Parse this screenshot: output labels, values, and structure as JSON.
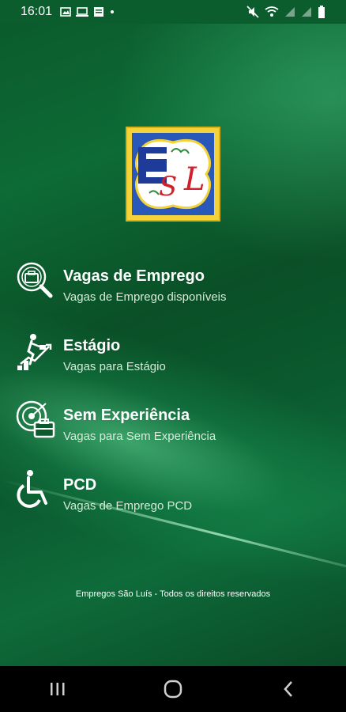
{
  "status_bar": {
    "time": "16:01",
    "left_icons": [
      "image-icon",
      "laptop-icon",
      "news-icon",
      "dot-icon"
    ],
    "right_icons": [
      "mute-icon",
      "wifi-icon",
      "signal-icon",
      "signal-icon",
      "battery-icon"
    ]
  },
  "logo": {
    "letters": [
      "E",
      "S",
      "L"
    ]
  },
  "menu": {
    "items": [
      {
        "title": "Vagas de Emprego",
        "subtitle": "Vagas de Emprego disponíveis",
        "icon": "job-search-icon"
      },
      {
        "title": "Estágio",
        "subtitle": "Vagas para Estágio",
        "icon": "career-growth-icon"
      },
      {
        "title": "Sem Experiência",
        "subtitle": "Vagas para Sem Experiência",
        "icon": "target-briefcase-icon"
      },
      {
        "title": "PCD",
        "subtitle": "Vagas de Emprego PCD",
        "icon": "wheelchair-icon"
      }
    ]
  },
  "footer": {
    "text": "Empregos São Luís - Todos os direitos reservados"
  },
  "nav_bar": {
    "buttons": [
      "recent-apps-icon",
      "home-icon",
      "back-icon"
    ]
  },
  "colors": {
    "background": "#0b5b2c",
    "status_bar": "#0b5d2e",
    "text": "#ffffff",
    "logo_border": "#d9b21a",
    "logo_blue": "#1f3b9a",
    "logo_red": "#d0202a"
  }
}
